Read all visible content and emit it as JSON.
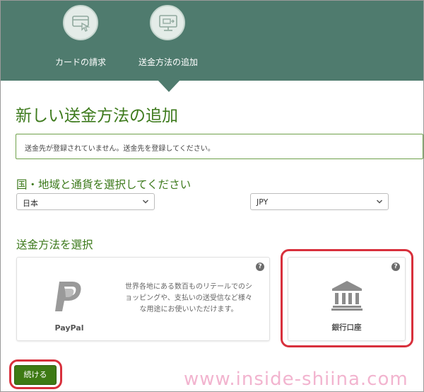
{
  "steps": [
    {
      "label": "カードの請求",
      "icon": "card-billing-icon"
    },
    {
      "label": "送金方法の追加",
      "icon": "computer-transfer-icon"
    }
  ],
  "page_title": "新しい送金方法の追加",
  "notice": "送金先が登録されていません。送金先を登録してください。",
  "country_section": {
    "title": "国・地域と通貨を選択してください",
    "country_value": "日本",
    "currency_value": "JPY"
  },
  "method_section": {
    "title": "送金方法を選択",
    "paypal": {
      "label": "PayPal",
      "description": "世界各地にある数百ものリテールでのショッピングや、支払いの送受信など様々な用途にお使いいただけます。",
      "help": "?"
    },
    "bank": {
      "label": "銀行口座",
      "help": "?"
    }
  },
  "continue_label": "続ける",
  "watermark": "www.inside-shiina.com",
  "colors": {
    "header": "#4f7b6e",
    "accent_green": "#3d7a1c",
    "button": "#3e7a14",
    "highlight": "#d8303c",
    "watermark": "#f2b4cf"
  }
}
